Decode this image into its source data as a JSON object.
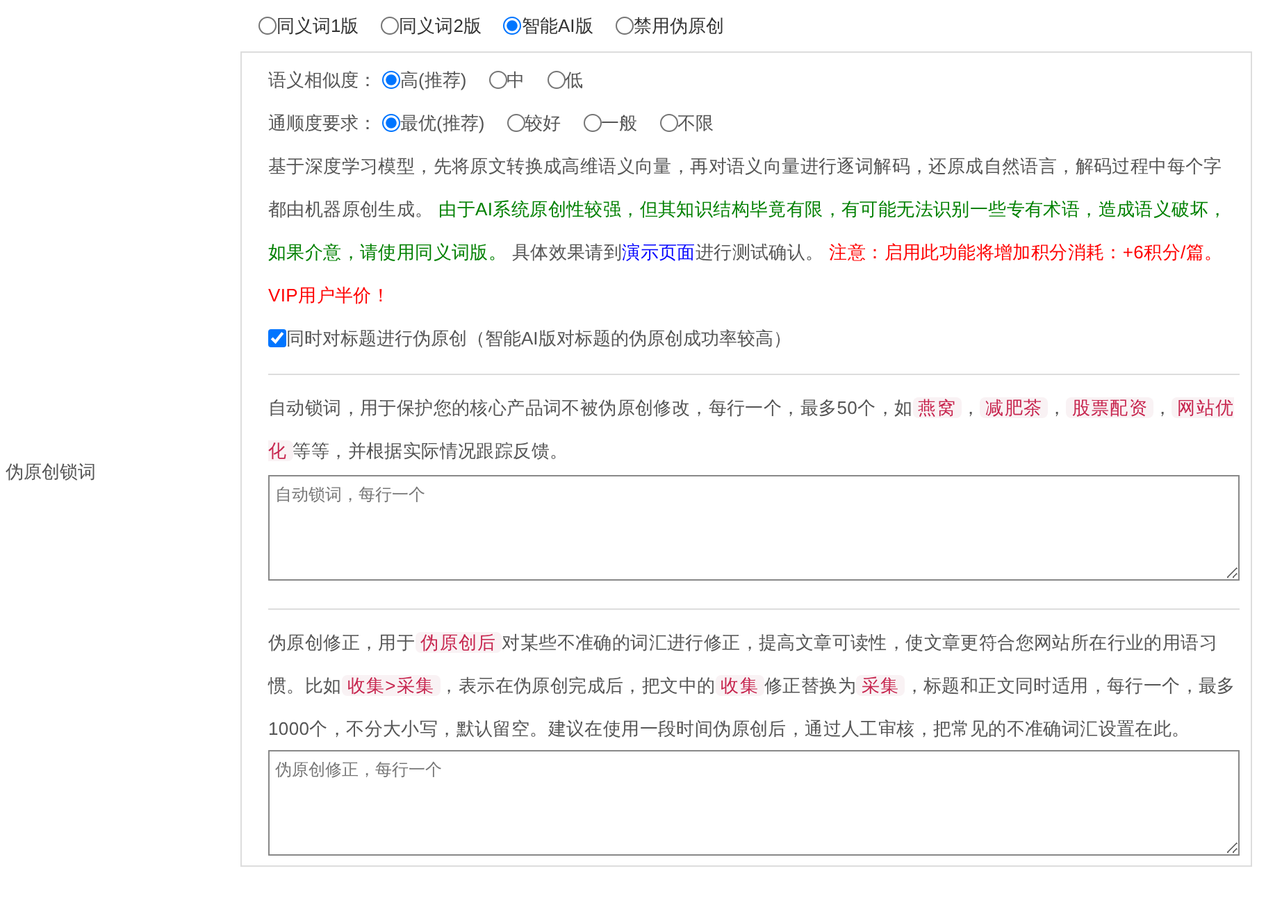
{
  "mode_options": [
    {
      "label": "同义词1版",
      "selected": false
    },
    {
      "label": "同义词2版",
      "selected": false
    },
    {
      "label": "智能AI版",
      "selected": true
    },
    {
      "label": "禁用伪原创",
      "selected": false
    }
  ],
  "ai_settings": {
    "rows": [
      {
        "label": "语义相似度：",
        "options": [
          {
            "label": "高(推荐)",
            "selected": true
          },
          {
            "label": "中",
            "selected": false
          },
          {
            "label": "低",
            "selected": false
          }
        ]
      },
      {
        "label": "通顺度要求：",
        "options": [
          {
            "label": "最优(推荐)",
            "selected": true
          },
          {
            "label": "较好",
            "selected": false
          },
          {
            "label": "一般",
            "selected": false
          },
          {
            "label": "不限",
            "selected": false
          }
        ]
      }
    ],
    "description": [
      {
        "kind": "plain",
        "text": "基于深度学习模型，先将原文转换成高维语义向量，再对语义向量进行逐词解码，还原成自然语言，解码过程中每个字都由机器原创生成。 "
      },
      {
        "kind": "success",
        "text": "由于AI系统原创性较强，但其知识结构毕竟有限，有可能无法识别一些专有术语，造成语义破坏，如果介意，请使用同义词版。"
      },
      {
        "kind": "plain",
        "text": " 具体效果请到"
      },
      {
        "kind": "link",
        "text": "演示页面"
      },
      {
        "kind": "plain",
        "text": "进行测试确认。 "
      },
      {
        "kind": "warning",
        "text": "注意：启用此功能将增加积分消耗：+6积分/篇。VIP用户半价！"
      }
    ],
    "title_checkbox": {
      "label": "同时对标题进行伪原创（智能AI版对标题的伪原创成功率较高）",
      "checked": true
    }
  },
  "lock_words": {
    "label": "伪原创锁词",
    "description": [
      {
        "kind": "plain",
        "text": "自动锁词，用于保护您的核心产品词不被伪原创修改，每行一个，最多50个，如"
      },
      {
        "kind": "code",
        "text": "燕窝"
      },
      {
        "kind": "plain",
        "text": "，"
      },
      {
        "kind": "code",
        "text": "减肥茶"
      },
      {
        "kind": "plain",
        "text": "，"
      },
      {
        "kind": "code",
        "text": "股票配资"
      },
      {
        "kind": "plain",
        "text": "，"
      },
      {
        "kind": "code",
        "text": "网站优化"
      },
      {
        "kind": "plain",
        "text": "等等，并根据实际情况跟踪反馈。"
      }
    ],
    "placeholder": "自动锁词，每行一个"
  },
  "correction": {
    "description": [
      {
        "kind": "plain",
        "text": "伪原创修正，用于"
      },
      {
        "kind": "code",
        "text": "伪原创后"
      },
      {
        "kind": "plain",
        "text": "对某些不准确的词汇进行修正，提高文章可读性，使文章更符合您网站所在行业的用语习惯。比如"
      },
      {
        "kind": "code",
        "text": "收集>采集"
      },
      {
        "kind": "plain",
        "text": "，表示在伪原创完成后，把文中的"
      },
      {
        "kind": "code",
        "text": "收集"
      },
      {
        "kind": "plain",
        "text": "修正替换为"
      },
      {
        "kind": "code",
        "text": "采集"
      },
      {
        "kind": "plain",
        "text": "，标题和正文同时适用，每行一个，最多1000个，不分大小写，默认留空。建议在使用一段时间伪原创后，通过人工审核，把常见的不准确词汇设置在此。"
      }
    ],
    "placeholder": "伪原创修正，每行一个"
  }
}
